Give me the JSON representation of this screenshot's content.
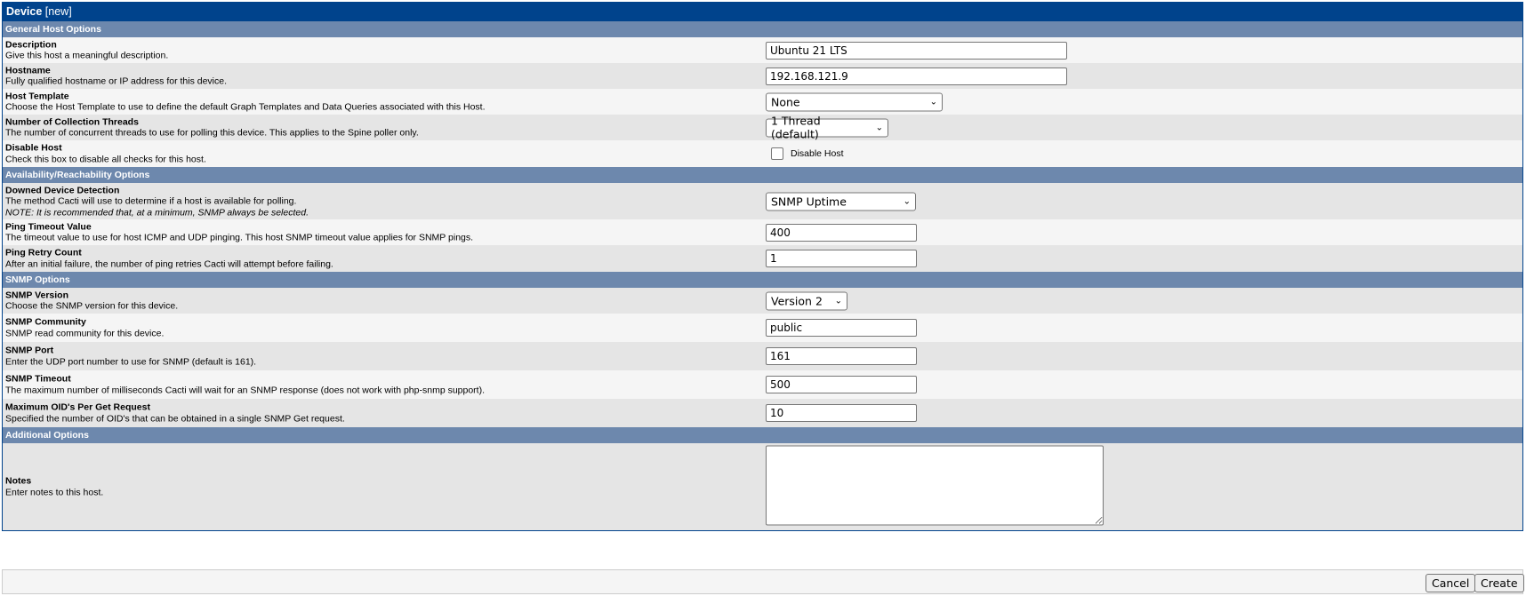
{
  "window": {
    "title": "Device",
    "title_suffix": "[new]"
  },
  "sections": {
    "general": "General Host Options",
    "availability": "Availability/Reachability Options",
    "snmp": "SNMP Options",
    "additional": "Additional Options"
  },
  "fields": {
    "description": {
      "label": "Description",
      "help": "Give this host a meaningful description.",
      "value": "Ubuntu 21 LTS"
    },
    "hostname": {
      "label": "Hostname",
      "help": "Fully qualified hostname or IP address for this device.",
      "value": "192.168.121.9"
    },
    "host_template": {
      "label": "Host Template",
      "help": "Choose the Host Template to use to define the default Graph Templates and Data Queries associated with this Host.",
      "value": "None"
    },
    "threads": {
      "label": "Number of Collection Threads",
      "help": "The number of concurrent threads to use for polling this device. This applies to the Spine poller only.",
      "value": "1 Thread (default)"
    },
    "disable_host": {
      "label": "Disable Host",
      "help": "Check this box to disable all checks for this host.",
      "checkbox_label": "Disable Host",
      "checked": false
    },
    "downed_detection": {
      "label": "Downed Device Detection",
      "help": "The method Cacti will use to determine if a host is available for polling.",
      "note": "NOTE: It is recommended that, at a minimum, SNMP always be selected.",
      "value": "SNMP Uptime"
    },
    "ping_timeout": {
      "label": "Ping Timeout Value",
      "help": "The timeout value to use for host ICMP and UDP pinging. This host SNMP timeout value applies for SNMP pings.",
      "value": "400"
    },
    "ping_retry": {
      "label": "Ping Retry Count",
      "help": "After an initial failure, the number of ping retries Cacti will attempt before failing.",
      "value": "1"
    },
    "snmp_version": {
      "label": "SNMP Version",
      "help": "Choose the SNMP version for this device.",
      "value": "Version 2"
    },
    "snmp_community": {
      "label": "SNMP Community",
      "help": "SNMP read community for this device.",
      "value": "public"
    },
    "snmp_port": {
      "label": "SNMP Port",
      "help": "Enter the UDP port number to use for SNMP (default is 161).",
      "value": "161"
    },
    "snmp_timeout": {
      "label": "SNMP Timeout",
      "help": "The maximum number of milliseconds Cacti will wait for an SNMP response (does not work with php-snmp support).",
      "value": "500"
    },
    "max_oids": {
      "label": "Maximum OID's Per Get Request",
      "help": "Specified the number of OID's that can be obtained in a single SNMP Get request.",
      "value": "10"
    },
    "notes": {
      "label": "Notes",
      "help": "Enter notes to this host.",
      "value": ""
    }
  },
  "buttons": {
    "cancel": "Cancel",
    "create": "Create"
  },
  "colors": {
    "title_bar": "#00438c",
    "section_bar": "#6d88ad",
    "row_light": "#f5f5f5",
    "row_dark": "#e5e5e5"
  }
}
